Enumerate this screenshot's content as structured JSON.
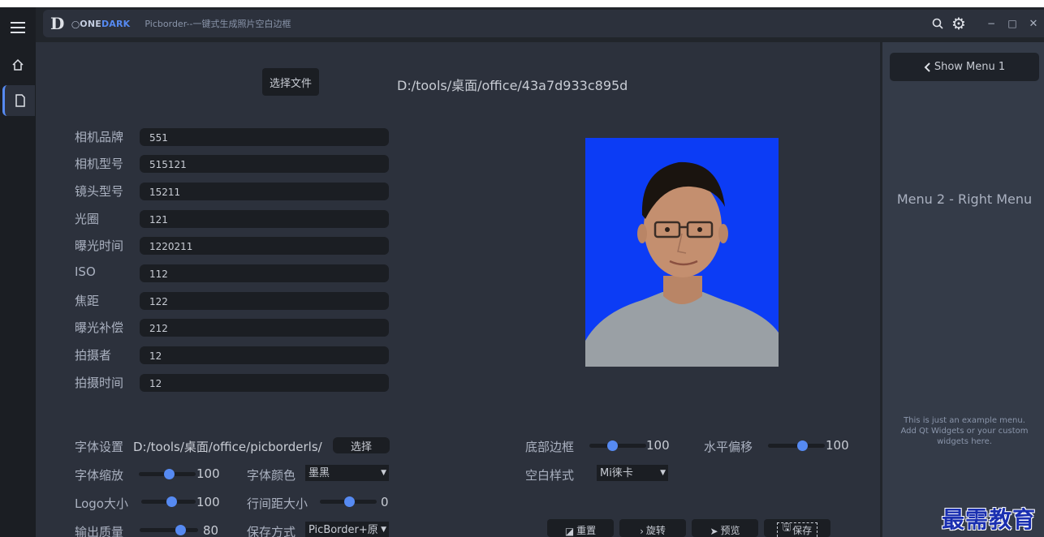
{
  "titlebar": {
    "brand_prefix": "ONE",
    "brand_accent": "DARK",
    "title": "Picborder--一键式生成照片空白边框"
  },
  "file": {
    "select_button": "选择文件",
    "path": "D:/tools/桌面/office/43a7d933c895d"
  },
  "fields": [
    {
      "label": "相机品牌",
      "value": "551"
    },
    {
      "label": "相机型号",
      "value": "515121"
    },
    {
      "label": "镜头型号",
      "value": "15211"
    },
    {
      "label": "光圈",
      "value": "121"
    },
    {
      "label": "曝光时间",
      "value": "1220211"
    },
    {
      "label": "ISO",
      "value": "112"
    },
    {
      "label": "焦距",
      "value": "122"
    },
    {
      "label": "曝光补偿",
      "value": "212"
    },
    {
      "label": "拍摄者",
      "value": "12"
    },
    {
      "label": "拍摄时间",
      "value": "12"
    }
  ],
  "font": {
    "label": "字体设置",
    "path": "D:/tools/桌面/office/picborderls/",
    "select_button": "选择"
  },
  "settings": {
    "font_scale": {
      "label": "字体缩放",
      "value": "100"
    },
    "font_color": {
      "label": "字体颜色",
      "value": "墨黑"
    },
    "logo_size": {
      "label": "Logo大小",
      "value": "100"
    },
    "line_spacing": {
      "label": "行间距大小",
      "value": "0"
    },
    "output_quality": {
      "label": "输出质量",
      "value": "80"
    },
    "save_mode": {
      "label": "保存方式",
      "value": "PicBorder+原"
    },
    "bottom_border": {
      "label": "底部边框",
      "value": "100"
    },
    "horizontal_offset": {
      "label": "水平偏移",
      "value": "100"
    },
    "blank_style": {
      "label": "空白样式",
      "value": "Mi徕卡"
    }
  },
  "actions": {
    "reset": "重置",
    "rotate": "旋转",
    "preview": "预览",
    "save": "保存"
  },
  "right_menu": {
    "show_menu_button": "Show Menu 1",
    "title": "Menu 2 - Right Menu",
    "description": "This is just an example menu. Add Qt Widgets or your custom widgets here."
  },
  "watermark": "最需教育",
  "colors": {
    "accent": "#568af2",
    "background": "#2c313c",
    "dark": "#1b1e23",
    "photo_background": "#0c3cf5"
  }
}
